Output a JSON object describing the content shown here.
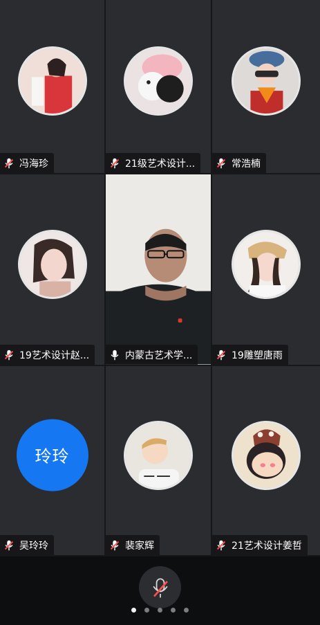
{
  "participants": [
    {
      "name": "冯海珍"
    },
    {
      "name": "21级艺术设计..."
    },
    {
      "name": "常浩楠"
    },
    {
      "name": "19艺术设计赵..."
    },
    {
      "name": "内蒙古艺术学..."
    },
    {
      "name": "19雕塑唐雨"
    },
    {
      "name": "吴玲玲",
      "avatar_text": "玲玲"
    },
    {
      "name": "裴家辉"
    },
    {
      "name": "21艺术设计姜哲"
    }
  ],
  "bottom": {
    "mic_state": "muted",
    "page_count": 5,
    "active_page": 1
  },
  "colors": {
    "tile": "#2a2c2f",
    "letter_avatar": "#1577f1",
    "muted_icon": "#ff4d4d"
  }
}
